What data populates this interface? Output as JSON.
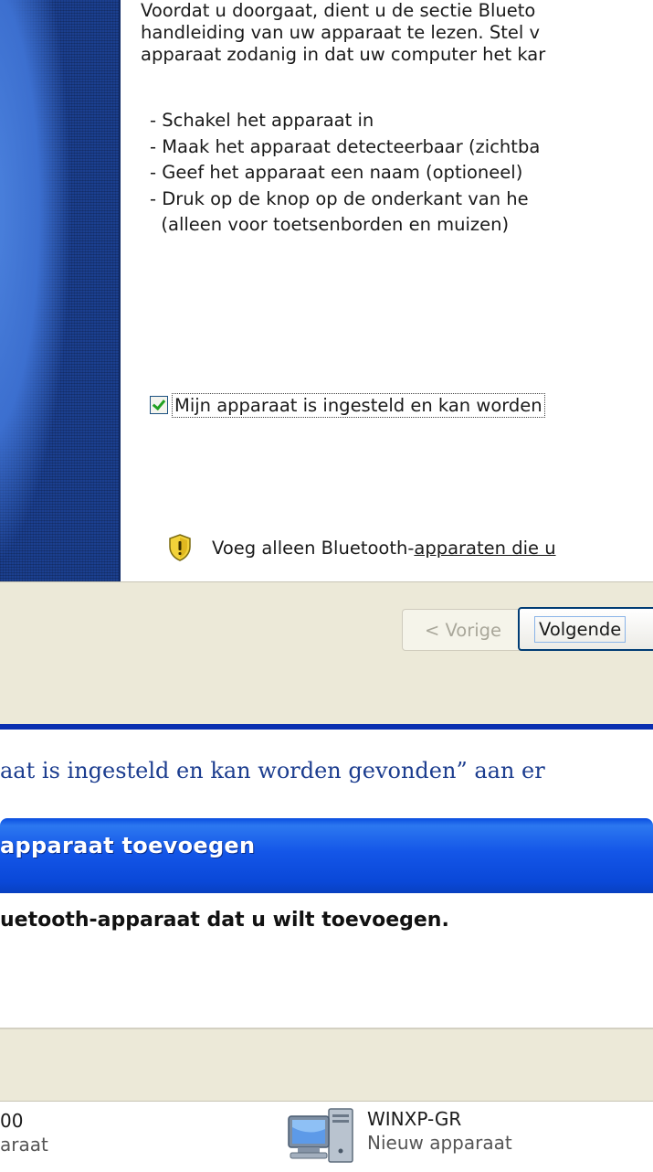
{
  "wizard_top": {
    "intro_lines": [
      "Voordat u doorgaat, dient u de sectie Blueto",
      "handleiding van uw apparaat te lezen. Stel v",
      "apparaat zodanig in dat uw computer het kar"
    ],
    "steps": [
      "- Schakel het apparaat in",
      "- Maak het apparaat detecteerbaar (zichtba",
      "- Geef het apparaat een naam (optioneel)",
      "- Druk op de knop op de onderkant van he",
      "  (alleen voor toetsenborden en muizen)"
    ],
    "checkbox_label": "Mijn apparaat is ingesteld en kan worden",
    "checkbox_checked": true,
    "warning_prefix": "Voeg alleen Bluetooth-",
    "warning_link": "apparaten die u",
    "prev_button": "< Vorige",
    "next_button": "Volgende"
  },
  "caption": "aat is ingesteld en kan worden gevonden” aan er",
  "wizard_bottom": {
    "title": "apparaat toevoegen",
    "header": "uetooth-apparaat dat u wilt toevoegen.",
    "devices": [
      {
        "name": "00",
        "status": "araat"
      },
      {
        "name": "WINXP-GR",
        "status": "Nieuw apparaat",
        "icon": "computer-icon"
      }
    ]
  },
  "colors": {
    "side_panel": "#1b3f8f",
    "title_bar": "#1456e8",
    "caption": "#1c3d8f",
    "dialog_gray": "#ece9d8"
  }
}
